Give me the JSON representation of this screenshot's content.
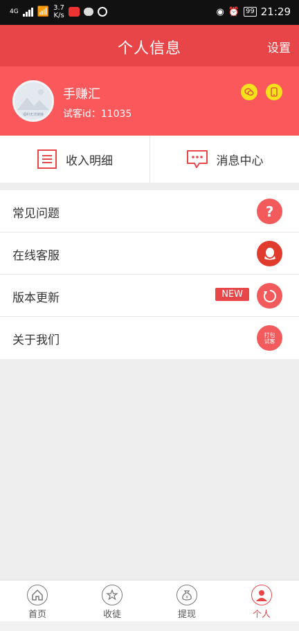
{
  "status_bar": {
    "network": "4G",
    "speed_value": "3.7",
    "speed_unit": "K/s",
    "battery": "99",
    "time": "21:29"
  },
  "header": {
    "title": "个人信息",
    "settings_label": "设置"
  },
  "profile": {
    "username": "手赚汇",
    "user_id": "试客id：11035",
    "avatar_caption": "福利无法链接"
  },
  "quick_actions": [
    {
      "label": "收入明细",
      "icon": "list-icon"
    },
    {
      "label": "消息中心",
      "icon": "message-icon"
    }
  ],
  "menu": [
    {
      "label": "常见问题",
      "icon": "question-icon"
    },
    {
      "label": "在线客服",
      "icon": "qq-icon"
    },
    {
      "label": "版本更新",
      "icon": "refresh-icon",
      "badge": "NEW"
    },
    {
      "label": "关于我们",
      "icon": "about-icon",
      "icon_text_1": "打包",
      "icon_text_2": "试客"
    }
  ],
  "tabbar": [
    {
      "label": "首页",
      "icon": "home-icon",
      "active": false
    },
    {
      "label": "收徒",
      "icon": "star-icon",
      "active": false
    },
    {
      "label": "提现",
      "icon": "money-bag-icon",
      "active": false
    },
    {
      "label": "个人",
      "icon": "person-icon",
      "active": true
    }
  ],
  "colors": {
    "header": "#e84549",
    "profile": "#fa585a",
    "accent": "#f25a5c",
    "badge_yellow": "#f6e21c"
  }
}
